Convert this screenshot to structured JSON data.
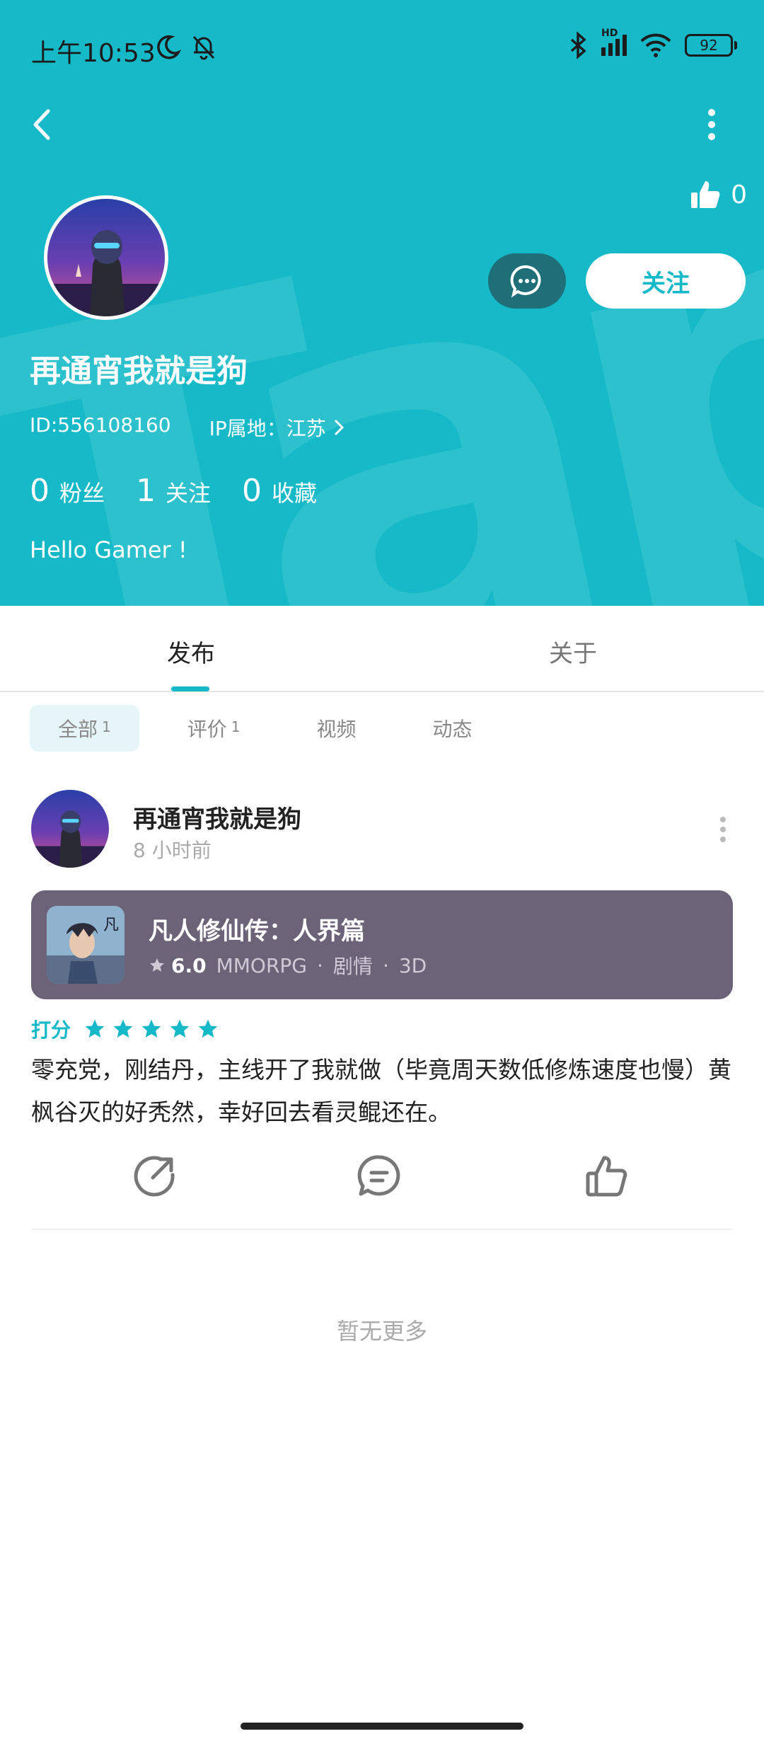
{
  "status_bar": {
    "time": "上午10:53",
    "battery": "92",
    "network": "HD"
  },
  "header": {
    "likes": "0",
    "follow_label": "关注",
    "username": "再通宵我就是狗",
    "id": "ID:556108160",
    "ip_location": "IP属地：江苏",
    "stats": [
      {
        "num": "0",
        "label": "粉丝"
      },
      {
        "num": "1",
        "label": "关注"
      },
      {
        "num": "0",
        "label": "收藏"
      }
    ],
    "bio": "Hello Gamer !",
    "watermark": "TapTap"
  },
  "tabs": {
    "publish": "发布",
    "about": "关于"
  },
  "filters": [
    {
      "label": "全部",
      "count": "1"
    },
    {
      "label": "评价",
      "count": "1"
    },
    {
      "label": "视频",
      "count": ""
    },
    {
      "label": "动态",
      "count": ""
    }
  ],
  "post": {
    "author": "再通宵我就是狗",
    "time": "8 小时前",
    "game": {
      "title": "凡人修仙传：人界篇",
      "score": "6.0",
      "tags": [
        "MMORPG",
        "剧情",
        "3D"
      ]
    },
    "rating_label": "打分",
    "stars": 5,
    "text": "零充党，刚结丹，主线开了我就做（毕竟周天数低修炼速度也慢）黄枫谷灭的好秃然，幸好回去看灵鲲还在。"
  },
  "footer": {
    "no_more": "暂无更多"
  },
  "colors": {
    "accent": "#16b9c8",
    "card": "#6c6379",
    "msg_button": "#1e6f78"
  }
}
